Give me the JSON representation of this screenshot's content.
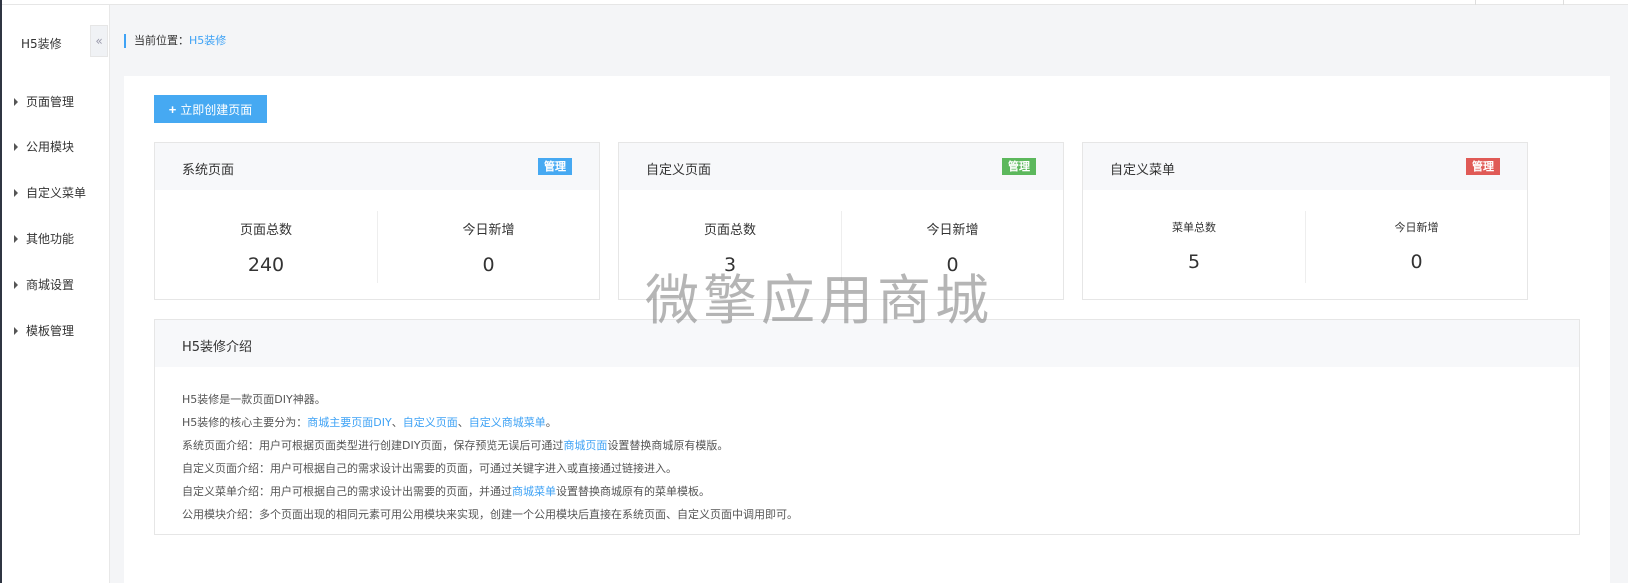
{
  "sidebar": {
    "title": "H5装修",
    "collapse_icon": "«",
    "items": [
      {
        "label": "页面管理"
      },
      {
        "label": "公用模块"
      },
      {
        "label": "自定义菜单"
      },
      {
        "label": "其他功能"
      },
      {
        "label": "商城设置"
      },
      {
        "label": "模板管理"
      }
    ]
  },
  "breadcrumb": {
    "prefix": "当前位置：",
    "current": "H5装修"
  },
  "create_button": {
    "icon": "+",
    "label": "立即创建页面"
  },
  "cards": [
    {
      "title": "系统页面",
      "badge": "管理",
      "badge_color": "#46a9f2",
      "stats": [
        {
          "label": "页面总数",
          "value": "240"
        },
        {
          "label": "今日新增",
          "value": "0"
        }
      ]
    },
    {
      "title": "自定义页面",
      "badge": "管理",
      "badge_color": "#5cb85c",
      "stats": [
        {
          "label": "页面总数",
          "value": "3"
        },
        {
          "label": "今日新增",
          "value": "0"
        }
      ]
    },
    {
      "title": "自定义菜单",
      "badge": "管理",
      "badge_color": "#e05a56",
      "stats": [
        {
          "label": "菜单总数",
          "value": "5"
        },
        {
          "label": "今日新增",
          "value": "0"
        }
      ]
    }
  ],
  "intro": {
    "title": "H5装修介绍",
    "line1": "H5装修是一款页面DIY神器。",
    "line2_prefix": "H5装修的核心主要分为：",
    "line2_link1": "商城主要页面DIY",
    "line2_sep1": "、",
    "line2_link2": "自定义页面",
    "line2_sep2": "、",
    "line2_link3": "自定义商城菜单",
    "line2_suffix": "。",
    "line3_prefix": "系统页面介绍：用户可根据页面类型进行创建DIY页面，保存预览无误后可通过",
    "line3_link": "商城页面",
    "line3_suffix": "设置替换商城原有模版。",
    "line4": "自定义页面介绍：用户可根据自己的需求设计出需要的页面，可通过关键字进入或直接通过链接进入。",
    "line5_prefix": "自定义菜单介绍：用户可根据自己的需求设计出需要的页面，并通过",
    "line5_link": "商城菜单",
    "line5_suffix": "设置替换商城原有的菜单模板。",
    "line6": "公用模块介绍：多个页面出现的相同元素可用公用模块来实现，创建一个公用模块后直接在系统页面、自定义页面中调用即可。"
  },
  "watermark": "微擎应用商城"
}
